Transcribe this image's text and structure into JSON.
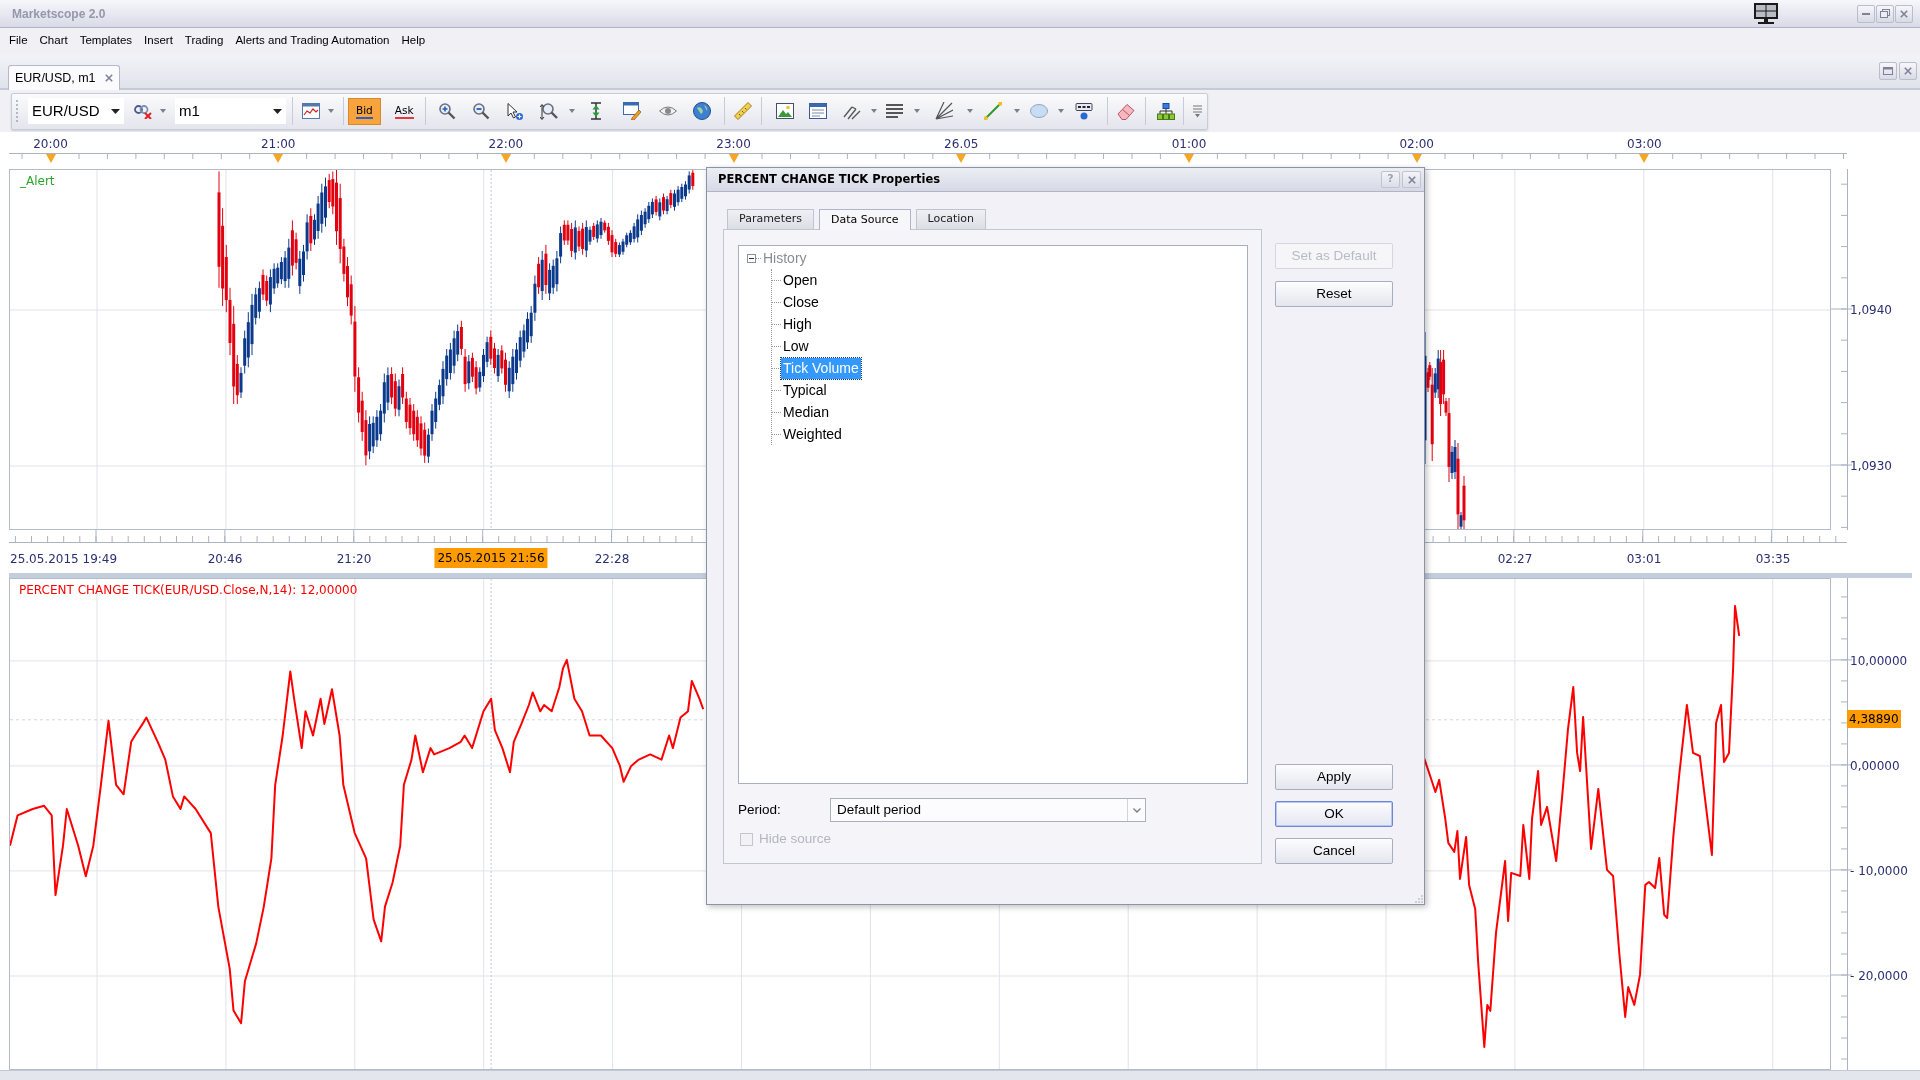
{
  "window": {
    "title": "Marketscope 2.0"
  },
  "menu": [
    "File",
    "Chart",
    "Templates",
    "Insert",
    "Trading",
    "Alerts and Trading Automation",
    "Help"
  ],
  "document_tabs": [
    {
      "label": "EUR/USD, m1",
      "selected": true
    }
  ],
  "toolbar": {
    "symbol": "EUR/USD",
    "timeframe": "m1",
    "price_buttons": [
      {
        "label": "Bid",
        "selected": true
      },
      {
        "label": "Ask",
        "selected": false
      }
    ]
  },
  "price_pane": {
    "top_time_labels": [
      "20:00",
      "21:00",
      "22:00",
      "23:00",
      "26.05",
      "01:00",
      "02:00",
      "03:00"
    ],
    "alert_label": "_Alert",
    "price_labels": [
      "1,0940",
      "1,0930"
    ],
    "bottom_time_labels": [
      {
        "text": "25.05.2015 19:49",
        "kind": "time"
      },
      {
        "text": "20:46",
        "kind": "time"
      },
      {
        "text": "21:20",
        "kind": "time"
      },
      {
        "text": "25.05.2015 21:56",
        "kind": "cursor"
      },
      {
        "text": "22:28",
        "kind": "time"
      },
      {
        "text": "02:27",
        "kind": "time"
      },
      {
        "text": "03:01",
        "kind": "time"
      },
      {
        "text": "03:35",
        "kind": "time"
      }
    ]
  },
  "indicator_pane": {
    "title": "PERCENT CHANGE TICK(EUR/USD.Close,N,14): 12,00000",
    "value_labels": [
      "10,00000",
      "0,00000",
      "- 10,0000",
      "- 20,0000"
    ],
    "current_value": "4,38890"
  },
  "dialog": {
    "title": "PERCENT CHANGE TICK Properties",
    "help_button": "?",
    "tabs": [
      {
        "label": "Parameters",
        "selected": false
      },
      {
        "label": "Data Source",
        "selected": true
      },
      {
        "label": "Location",
        "selected": false
      }
    ],
    "source_tree": [
      {
        "label": "History",
        "expanded": true,
        "disabled": true,
        "selected": false,
        "children": [
          {
            "label": "Open",
            "disabled": false,
            "selected": false
          },
          {
            "label": "Close",
            "disabled": false,
            "selected": false
          },
          {
            "label": "High",
            "disabled": false,
            "selected": false
          },
          {
            "label": "Low",
            "disabled": false,
            "selected": false
          },
          {
            "label": "Tick Volume",
            "disabled": false,
            "selected": true
          },
          {
            "label": "Typical",
            "disabled": false,
            "selected": false
          },
          {
            "label": "Median",
            "disabled": false,
            "selected": false
          },
          {
            "label": "Weighted",
            "disabled": false,
            "selected": false
          }
        ]
      }
    ],
    "period": {
      "label": "Period:",
      "value": "Default period"
    },
    "hide_source": {
      "label": "Hide source",
      "checked": false,
      "disabled": true
    },
    "side_buttons": [
      {
        "label": "Set as Default",
        "disabled": true,
        "default": false
      },
      {
        "label": "Reset",
        "disabled": false,
        "default": false
      }
    ],
    "footer_buttons": [
      {
        "label": "Apply",
        "disabled": false,
        "default": false
      },
      {
        "label": "OK",
        "disabled": false,
        "default": true
      },
      {
        "label": "Cancel",
        "disabled": false,
        "default": false
      }
    ]
  }
}
